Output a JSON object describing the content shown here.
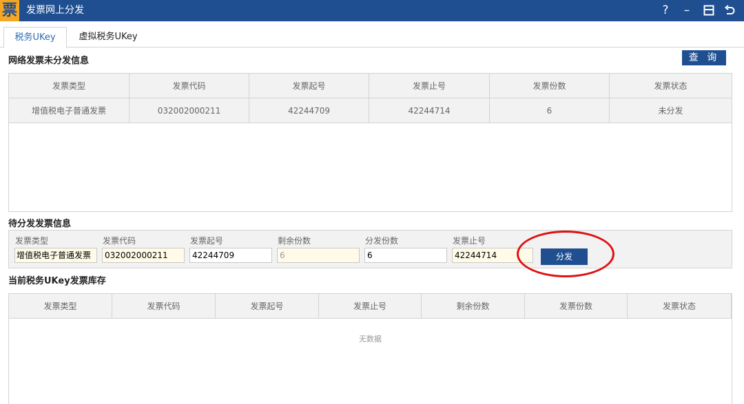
{
  "titlebar": {
    "logo_char": "票",
    "title": "发票网上分发",
    "help": "?",
    "minimize": "–"
  },
  "tabs": [
    {
      "label": "税务UKey",
      "active": true
    },
    {
      "label": "虚拟税务UKey",
      "active": false
    }
  ],
  "online_section": {
    "title": "网络发票未分发信息",
    "query_button": "查 询",
    "columns": [
      "发票类型",
      "发票代码",
      "发票起号",
      "发票止号",
      "发票份数",
      "发票状态"
    ],
    "rows": [
      [
        "增值税电子普通发票",
        "032002000211",
        "42244709",
        "42244714",
        "6",
        "未分发"
      ]
    ]
  },
  "pending_section": {
    "title": "待分发发票信息",
    "fields": {
      "type": {
        "label": "发票类型",
        "value": "增值税电子普通发票"
      },
      "code": {
        "label": "发票代码",
        "value": "032002000211"
      },
      "start": {
        "label": "发票起号",
        "value": "42244709"
      },
      "remaining": {
        "label": "剩余份数",
        "value": "6"
      },
      "count": {
        "label": "分发份数",
        "value": "6"
      },
      "end": {
        "label": "发票止号",
        "value": "42244714"
      }
    },
    "distribute_button": "分发"
  },
  "inventory_section": {
    "title": "当前税务UKey发票库存",
    "columns": [
      "发票类型",
      "发票代码",
      "发票起号",
      "发票止号",
      "剩余份数",
      "发票份数",
      "发票状态"
    ],
    "empty_text": "无数据"
  },
  "colors": {
    "titlebar": "#1f4f91",
    "accent": "#2a6bb0",
    "highlight_circle": "#e01010"
  }
}
